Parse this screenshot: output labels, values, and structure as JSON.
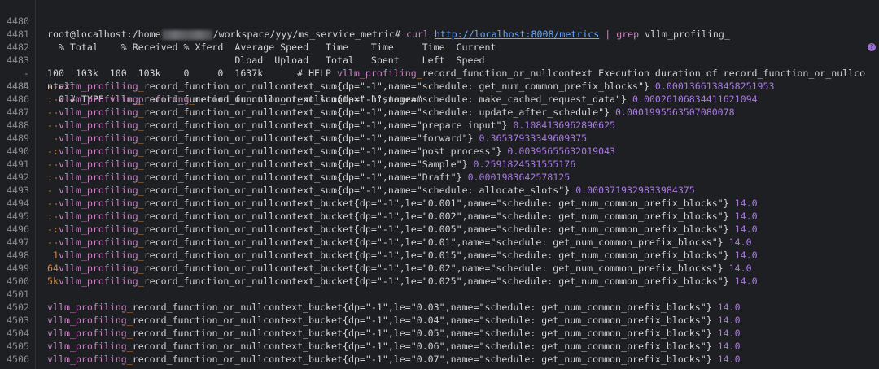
{
  "terminal": {
    "prompt": {
      "user_host": "root@localhost:",
      "path_a": "/home",
      "path_b": "/workspace/yyy/ms_service_metric#",
      "cmd": "curl",
      "url": "http://localhost:8008/metrics",
      "pipe": "|",
      "grep": "grep",
      "pattern": "vllm_profiling_"
    },
    "metric_prefix": "vllm_profiling",
    "metric_sep": "_",
    "header1": "  % Total    % Received % Xferd  Average Speed   Time    Time     Time  Current",
    "header2": "                                 Dload  Upload   Total   Spent    Left  Speed",
    "progress": "100  103k  100  103k    0     0  1637k      # HELP ",
    "help_rest": "record_function_or_nullcontext Execution duration of record_function_or_nullco",
    "help_wrap": "ntext",
    "type_pre": "  0 # TYPE ",
    "type_rest": "record_function_or_nullcontext histogram",
    "wrap_dash": "-",
    "line_numbers": [
      "4480",
      "4481",
      "4482",
      "4483",
      "4484",
      "4485",
      "4486",
      "4487",
      "4488",
      "4489",
      "4490",
      "4491",
      "4492",
      "4493",
      "4494",
      "4495",
      "4496",
      "4497",
      "4498",
      "4499",
      "4500",
      "4501",
      "4502",
      "4503",
      "4504",
      "4505",
      "4506"
    ],
    "sum_lines": [
      {
        "lead": "--",
        "name": "record_function_or_nullcontext_sum",
        "labels": "{dp=\"-1\",name=\"schedule: get_num_common_prefix_blocks\"}",
        "value": "0.0001366138458251953"
      },
      {
        "lead": ":-",
        "name": "record_function_or_nullcontext_sum",
        "labels": "{dp=\"-1\",name=\"schedule: make_cached_request_data\"}",
        "value": "0.00026106834411621094"
      },
      {
        "lead": "--",
        "name": "record_function_or_nullcontext_sum",
        "labels": "{dp=\"-1\",name=\"schedule: update_after_schedule\"}",
        "value": "0.0001995563507080078"
      },
      {
        "lead": "--",
        "name": "record_function_or_nullcontext_sum",
        "labels": "{dp=\"-1\",name=\"prepare input\"}",
        "value": "0.1084136962890625"
      },
      {
        "lead": " -",
        "name": "record_function_or_nullcontext_sum",
        "labels": "{dp=\"-1\",name=\"forward\"}",
        "value": "0.36537933349609375"
      },
      {
        "lead": "-:",
        "name": "record_function_or_nullcontext_sum",
        "labels": "{dp=\"-1\",name=\"post process\"}",
        "value": "0.00395655632019043"
      },
      {
        "lead": "--",
        "name": "record_function_or_nullcontext_sum",
        "labels": "{dp=\"-1\",name=\"Sample\"}",
        "value": "0.2591824531555176"
      },
      {
        "lead": ":-",
        "name": "record_function_or_nullcontext_sum",
        "labels": "{dp=\"-1\",name=\"Draft\"}",
        "value": "0.0001983642578125"
      },
      {
        "lead": "- ",
        "name": "record_function_or_nullcontext_sum",
        "labels": "{dp=\"-1\",name=\"schedule: allocate_slots\"}",
        "value": "0.0003719329833984375"
      }
    ],
    "bucket_lines_a": [
      {
        "lead": "--",
        "name": "record_function_or_nullcontext_bucket",
        "labels": "{dp=\"-1\",le=\"0.001\",name=\"schedule: get_num_common_prefix_blocks\"}",
        "value": "14.0"
      },
      {
        "lead": ":-",
        "name": "record_function_or_nullcontext_bucket",
        "labels": "{dp=\"-1\",le=\"0.002\",name=\"schedule: get_num_common_prefix_blocks\"}",
        "value": "14.0"
      },
      {
        "lead": "-:",
        "name": "record_function_or_nullcontext_bucket",
        "labels": "{dp=\"-1\",le=\"0.005\",name=\"schedule: get_num_common_prefix_blocks\"}",
        "value": "14.0"
      },
      {
        "lead": "--",
        "name": "record_function_or_nullcontext_bucket",
        "labels": "{dp=\"-1\",le=\"0.01\",name=\"schedule: get_num_common_prefix_blocks\"}",
        "value": "14.0"
      },
      {
        "lead": " 1",
        "name": "record_function_or_nullcontext_bucket",
        "labels": "{dp=\"-1\",le=\"0.015\",name=\"schedule: get_num_common_prefix_blocks\"}",
        "value": "14.0"
      },
      {
        "lead": "64",
        "name": "record_function_or_nullcontext_bucket",
        "labels": "{dp=\"-1\",le=\"0.02\",name=\"schedule: get_num_common_prefix_blocks\"}",
        "value": "14.0"
      },
      {
        "lead": "5k",
        "name": "record_function_or_nullcontext_bucket",
        "labels": "{dp=\"-1\",le=\"0.025\",name=\"schedule: get_num_common_prefix_blocks\"}",
        "value": "14.0"
      }
    ],
    "bucket_lines_b": [
      {
        "name": "record_function_or_nullcontext_bucket",
        "labels": "{dp=\"-1\",le=\"0.03\",name=\"schedule: get_num_common_prefix_blocks\"}",
        "value": "14.0"
      },
      {
        "name": "record_function_or_nullcontext_bucket",
        "labels": "{dp=\"-1\",le=\"0.04\",name=\"schedule: get_num_common_prefix_blocks\"}",
        "value": "14.0"
      },
      {
        "name": "record_function_or_nullcontext_bucket",
        "labels": "{dp=\"-1\",le=\"0.05\",name=\"schedule: get_num_common_prefix_blocks\"}",
        "value": "14.0"
      },
      {
        "name": "record_function_or_nullcontext_bucket",
        "labels": "{dp=\"-1\",le=\"0.06\",name=\"schedule: get_num_common_prefix_blocks\"}",
        "value": "14.0"
      },
      {
        "name": "record_function_or_nullcontext_bucket",
        "labels": "{dp=\"-1\",le=\"0.07\",name=\"schedule: get_num_common_prefix_blocks\"}",
        "value": "14.0"
      }
    ]
  }
}
